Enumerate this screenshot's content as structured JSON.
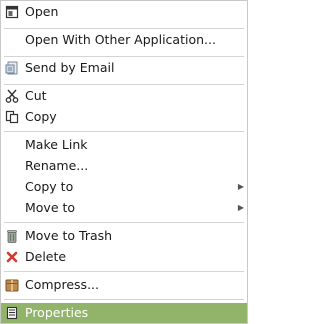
{
  "menu": {
    "open": "Open",
    "open_with": "Open With Other Application...",
    "send_email": "Send by Email",
    "cut": "Cut",
    "copy": "Copy",
    "make_link": "Make Link",
    "rename": "Rename...",
    "copy_to": "Copy to",
    "move_to": "Move to",
    "move_to_trash": "Move to Trash",
    "delete": "Delete",
    "compress": "Compress...",
    "properties": "Properties"
  },
  "icons": {
    "open": "open-window-icon",
    "send_email": "email-attachment-icon",
    "cut": "scissors-icon",
    "copy": "copy-icon",
    "submenu": "chevron-right-icon",
    "move_to_trash": "trash-icon",
    "delete": "red-x-icon",
    "compress": "archive-box-icon",
    "properties": "properties-document-icon"
  },
  "colors": {
    "selection": "#92b46a",
    "delete_icon": "#d23b2e"
  }
}
